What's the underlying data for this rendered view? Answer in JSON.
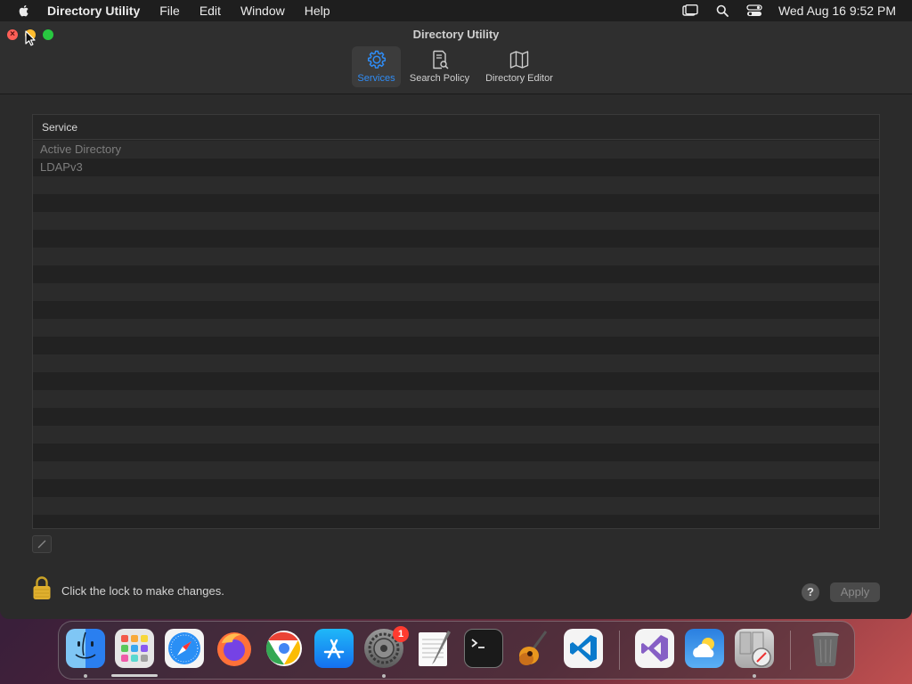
{
  "menubar": {
    "app_name": "Directory Utility",
    "items": [
      "File",
      "Edit",
      "Window",
      "Help"
    ],
    "clock": "Wed Aug 16  9:52 PM"
  },
  "window": {
    "title": "Directory Utility",
    "tabs": [
      {
        "label": "Services",
        "icon": "gear-icon",
        "active": true
      },
      {
        "label": "Search Policy",
        "icon": "search-policy-icon",
        "active": false
      },
      {
        "label": "Directory Editor",
        "icon": "map-icon",
        "active": false
      }
    ],
    "table": {
      "column_header": "Service",
      "rows": [
        "Active Directory",
        "LDAPv3"
      ]
    },
    "lock_text": "Click the lock to make changes.",
    "help_label": "?",
    "apply_label": "Apply"
  },
  "dock": {
    "apps": [
      {
        "name": "Finder",
        "icon": "finder-icon",
        "running": true
      },
      {
        "name": "Launchpad",
        "icon": "launchpad-icon",
        "running": false
      },
      {
        "name": "Safari",
        "icon": "safari-icon",
        "running": false
      },
      {
        "name": "Firefox",
        "icon": "firefox-icon",
        "running": false
      },
      {
        "name": "Chrome",
        "icon": "chrome-icon",
        "running": false
      },
      {
        "name": "App Store",
        "icon": "app-store-icon",
        "running": false
      },
      {
        "name": "System Settings",
        "icon": "system-settings-icon",
        "running": true,
        "badge": "1"
      },
      {
        "name": "TextEdit",
        "icon": "textedit-icon",
        "running": false
      },
      {
        "name": "Terminal",
        "icon": "terminal-icon",
        "running": false
      },
      {
        "name": "GarageBand",
        "icon": "garageband-icon",
        "running": false
      },
      {
        "name": "VS Code",
        "icon": "vscode-icon",
        "running": false
      },
      {
        "name": "Visual Studio",
        "icon": "visual-studio-icon",
        "running": false
      },
      {
        "name": "Weather",
        "icon": "weather-icon",
        "running": false
      },
      {
        "name": "Directory Utility",
        "icon": "directory-utility-icon",
        "running": true
      },
      {
        "name": "Trash",
        "icon": "trash-icon",
        "running": false
      }
    ]
  },
  "colors": {
    "accent": "#2f8cf5",
    "window_bg": "#2b2b2b",
    "close": "#ff5f57",
    "minimize": "#febc2e",
    "zoom": "#28c840"
  }
}
